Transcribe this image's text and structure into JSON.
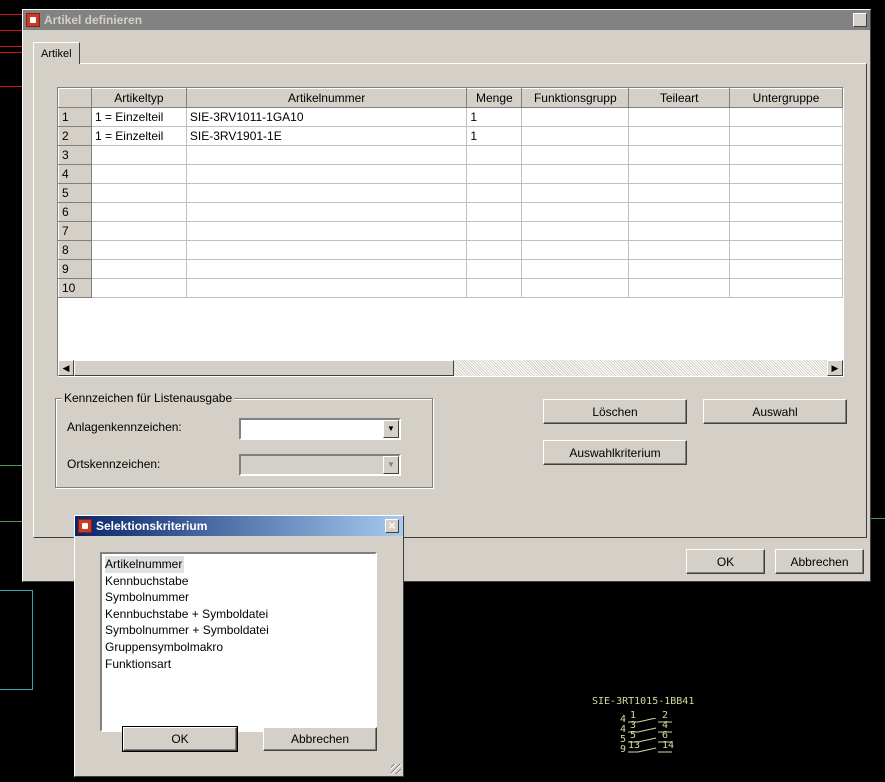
{
  "window": {
    "title": "Artikel definieren",
    "close": "×"
  },
  "tab": {
    "label": "Artikel"
  },
  "grid": {
    "columns": [
      "Artikeltyp",
      "Artikelnummer",
      "Menge",
      "Funktionsgrupp",
      "Teileart",
      "Untergruppe"
    ],
    "rows": [
      {
        "num": "1",
        "typ": "1 = Einzelteil",
        "nummer": "SIE-3RV1011-1GA10",
        "menge": "1"
      },
      {
        "num": "2",
        "typ": "1 = Einzelteil",
        "nummer": "SIE-3RV1901-1E",
        "menge": "1"
      },
      {
        "num": "3",
        "typ": "",
        "nummer": "",
        "menge": ""
      },
      {
        "num": "4",
        "typ": "",
        "nummer": "",
        "menge": ""
      },
      {
        "num": "5",
        "typ": "",
        "nummer": "",
        "menge": ""
      },
      {
        "num": "6",
        "typ": "",
        "nummer": "",
        "menge": ""
      },
      {
        "num": "7",
        "typ": "",
        "nummer": "",
        "menge": ""
      },
      {
        "num": "8",
        "typ": "",
        "nummer": "",
        "menge": ""
      },
      {
        "num": "9",
        "typ": "",
        "nummer": "",
        "menge": ""
      },
      {
        "num": "10",
        "typ": "",
        "nummer": "",
        "menge": ""
      }
    ]
  },
  "group": {
    "legend": "Kennzeichen für Listenausgabe",
    "anlage_label": "Anlagenkennzeichen:",
    "ort_label": "Ortskennzeichen:"
  },
  "buttons": {
    "loeschen": "Löschen",
    "auswahl": "Auswahl",
    "auswahlkriterium": "Auswahlkriterium",
    "ok": "OK",
    "abbrechen": "Abbrechen"
  },
  "selection_dialog": {
    "title": "Selektionskriterium",
    "items": [
      "Artikelnummer",
      "Kennbuchstabe",
      "Symbolnummer",
      "Kennbuchstabe + Symboldatei",
      "Symbolnummer + Symboldatei",
      "Gruppensymbolmakro",
      "Funktionsart"
    ],
    "selected_index": 0,
    "ok": "OK",
    "abbrechen": "Abbrechen"
  },
  "cad": {
    "component_label": "SIE-3RT1015-1BB41",
    "contacts": [
      "4",
      "4",
      "5",
      "9"
    ],
    "pins_top": [
      "1",
      "3",
      "5",
      "13"
    ],
    "pins_bottom": [
      "2",
      "4",
      "6",
      "14"
    ]
  },
  "colors": {
    "title_active": "#0a246a",
    "title_inactive": "#828282",
    "face": "#d4d0c8"
  }
}
